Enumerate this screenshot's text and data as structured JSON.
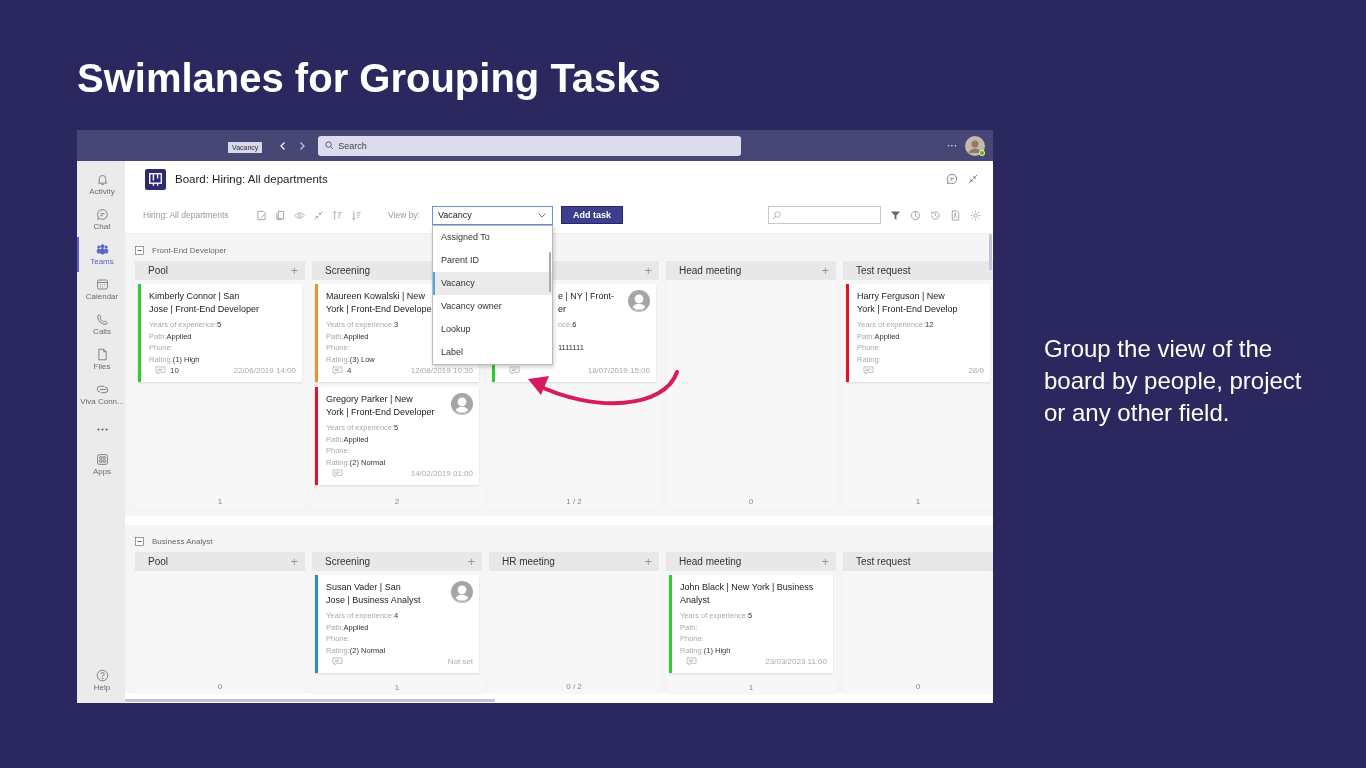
{
  "slide": {
    "title": "Swimlanes for Grouping Tasks",
    "caption": "Group the view of the board by people, project or any other field."
  },
  "topbar": {
    "tag": "Vacancy",
    "search_placeholder": "Search",
    "more": "···"
  },
  "rail": [
    {
      "kind": "app",
      "label": "Activity",
      "selected": false
    },
    {
      "kind": "app",
      "label": "Chat",
      "selected": false
    },
    {
      "kind": "app",
      "label": "Teams",
      "selected": true
    },
    {
      "kind": "app",
      "label": "Calendar",
      "selected": false
    },
    {
      "kind": "app",
      "label": "Calls",
      "selected": false
    },
    {
      "kind": "app",
      "label": "Files",
      "selected": false
    },
    {
      "kind": "app",
      "label": "Viva Conn...",
      "selected": false
    },
    {
      "kind": "more",
      "selected": false
    },
    {
      "kind": "app",
      "label": "Apps",
      "selected": false
    },
    {
      "kind": "help",
      "label": "Help",
      "selected": false
    }
  ],
  "header": {
    "title": "Board: Hiring: All departments"
  },
  "toolbar": {
    "board_name": "Hiring: All departments",
    "view_by_label": "View by:",
    "view_by_value": "Vacancy",
    "add_button": "Add task"
  },
  "view_menu": {
    "expanded": true,
    "options": [
      {
        "label": "Assigned To",
        "selected": false
      },
      {
        "label": "Parent ID",
        "selected": false
      },
      {
        "label": "Vacancy",
        "selected": true
      },
      {
        "label": "Vacancy owner",
        "selected": false
      },
      {
        "label": "Lookup",
        "selected": false
      },
      {
        "label": "Label",
        "selected": false
      }
    ]
  },
  "lanes": [
    {
      "name": "Front-End Developer",
      "expanded": true,
      "columns": [
        {
          "title": "Pool",
          "add": "+",
          "count": "1",
          "cards": [
            {
              "kind": "full",
              "title_lines": [
                "Kimberly Connor | San",
                "Jose | Front-End Developer"
              ],
              "color": "#2ecc2e",
              "avatar": false,
              "fields": {
                "years": {
                  "label": "Years of experience:",
                  "value": "5"
                },
                "path": {
                  "label": "Path:",
                  "value": "Applied"
                },
                "phone": {
                  "label": "Phone:"
                },
                "rating": {
                  "label": "Rating:",
                  "value": "(1) High"
                }
              },
              "comments": "10",
              "date": "22/06/2019 14:00"
            }
          ]
        },
        {
          "title": "Screening",
          "count": "2",
          "cards": [
            {
              "kind": "full",
              "title_lines": [
                "Maureen Kowalski | New",
                "York | Front-End Develope"
              ],
              "color": "#e8962e",
              "avatar": false,
              "fields": {
                "years": {
                  "label": "Years of experience:",
                  "value": "3"
                },
                "path": {
                  "label": "Path:",
                  "value": "Applied"
                },
                "phone": {
                  "label": "Phone:"
                },
                "rating": {
                  "label": "Rating:",
                  "value": "(3) Low"
                }
              },
              "comments": "4",
              "date": "12/08/2019 10:30"
            },
            {
              "kind": "full",
              "title_lines": [
                "Gregory Parker | New",
                "York | Front-End Developer"
              ],
              "color": "#e81123",
              "avatar": true,
              "fields": {
                "years": {
                  "label": "Years of experience:",
                  "value": "5"
                },
                "path": {
                  "label": "Path:",
                  "value": "Applied"
                },
                "phone": {
                  "label": "Phone:"
                },
                "rating": {
                  "label": "Rating:",
                  "value": "(2) Normal"
                }
              },
              "date": "14/02/2019 01:00"
            }
          ]
        },
        {
          "add": "+",
          "count": "1 / 2",
          "cards": [
            {
              "kind": "partial",
              "title_lines": [
                "e | NY | Front-",
                "er"
              ],
              "color": "#2ecc2e",
              "avatar": true,
              "fields": {
                "years": {
                  "label": "nce:",
                  "value": "6"
                },
                "phone": {
                  "value": "1111111"
                }
              },
              "date": "18/07/2019 15:00"
            }
          ]
        },
        {
          "title": "Head meeting",
          "add": "+",
          "count": "0"
        },
        {
          "title": "Test request",
          "count": "1",
          "cards": [
            {
              "kind": "full",
              "title_lines": [
                "Harry Ferguson | New",
                "York | Front-End Develop"
              ],
              "color": "#e81123",
              "avatar": false,
              "fields": {
                "years": {
                  "label": "Years of experience:",
                  "value": "12"
                },
                "path": {
                  "label": "Path:",
                  "value": "Applied"
                },
                "phone": {
                  "label": "Phone:"
                },
                "rating": {
                  "label": "Rating:"
                }
              },
              "date": "28/0"
            }
          ]
        }
      ]
    },
    {
      "name": "Business Analyst",
      "expanded": true,
      "columns": [
        {
          "title": "Pool",
          "add": "+",
          "count": "0"
        },
        {
          "title": "Screening",
          "add": "+",
          "count": "1",
          "cards": [
            {
              "kind": "full",
              "title_lines": [
                "Susan Vader | San",
                "Jose | Business Analyst"
              ],
              "color": "#2a8cc4",
              "avatar": true,
              "fields": {
                "years": {
                  "label": "Years of experience:",
                  "value": "4"
                },
                "path": {
                  "label": "Path:",
                  "value": "Applied"
                },
                "phone": {
                  "label": "Phone:"
                },
                "rating": {
                  "label": "Rating:",
                  "value": "(2) Normal"
                }
              },
              "date": "Not set"
            }
          ]
        },
        {
          "title": "HR meeting",
          "add": "+",
          "count": "0 / 2"
        },
        {
          "title": "Head meeting",
          "add": "+",
          "count": "1",
          "cards": [
            {
              "kind": "full",
              "title_lines": [
                "John Black | New York | Business",
                "Analyst"
              ],
              "color": "#2ecc2e",
              "avatar": false,
              "fields": {
                "years": {
                  "label": "Years of experience:",
                  "value": "5"
                },
                "path": {
                  "label": "Path:"
                },
                "phone": {
                  "label": "Phone:"
                },
                "rating": {
                  "label": "Rating:",
                  "value": "(1) High"
                }
              },
              "date": "23/03/2023 11:00"
            }
          ]
        },
        {
          "title": "Test request",
          "count": "0"
        }
      ]
    }
  ]
}
